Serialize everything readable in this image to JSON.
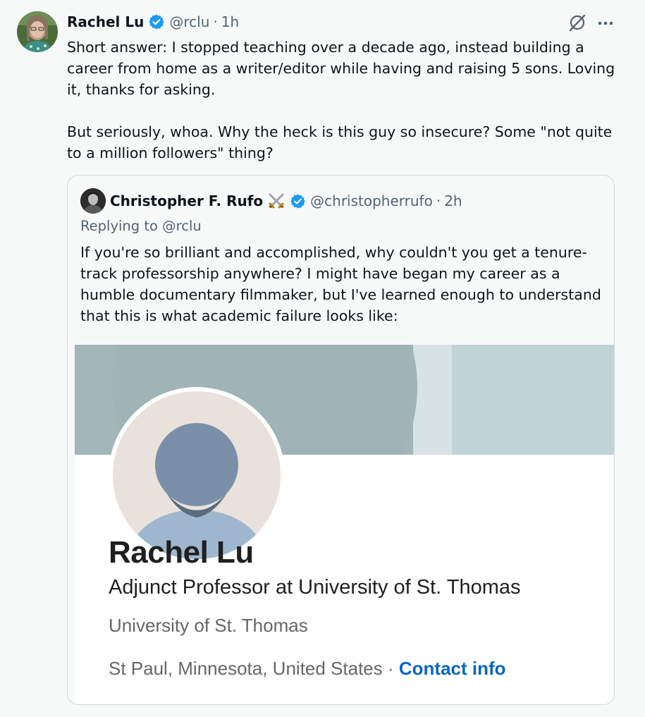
{
  "tweet": {
    "author_name": "Rachel Lu",
    "handle": "@rclu",
    "separator": "·",
    "time": "1h",
    "more_icon": "ellipsis-icon",
    "grok_icon": "grok-icon",
    "paragraphs": [
      "Short answer: I stopped teaching over a decade ago, instead building a career from home as a writer/editor while having and raising 5 sons. Loving it, thanks for asking.",
      "But seriously, whoa. Why the heck is this guy so insecure? Some \"not quite to a million followers\" thing?"
    ]
  },
  "quote": {
    "author_name": "Christopher F. Rufo",
    "emoji": "crossed-swords-icon",
    "handle": "@christopherrufo",
    "separator": "·",
    "time": "2h",
    "replying_prefix": "Replying to",
    "replying_mention": "@rclu",
    "text": "If you're so brilliant and accomplished, why couldn't you get a tenure-track professorship anywhere? I might have began my career as a humble documentary filmmaker, but I've learned enough to understand that this is what academic failure looks like:"
  },
  "linkedin": {
    "name": "Rachel Lu",
    "headline": "Adjunct Professor at University of St. Thomas",
    "organization": "University of St. Thomas",
    "location": "St Paul, Minnesota, United States",
    "location_sep": " · ",
    "contact_link": "Contact info"
  },
  "colors": {
    "verified_blue": "#1d9bf0",
    "link_blue": "#0a66c2",
    "secondary_text": "#536471",
    "banner_dark": "#a0b4b8",
    "banner_light": "#c0d4d8"
  }
}
